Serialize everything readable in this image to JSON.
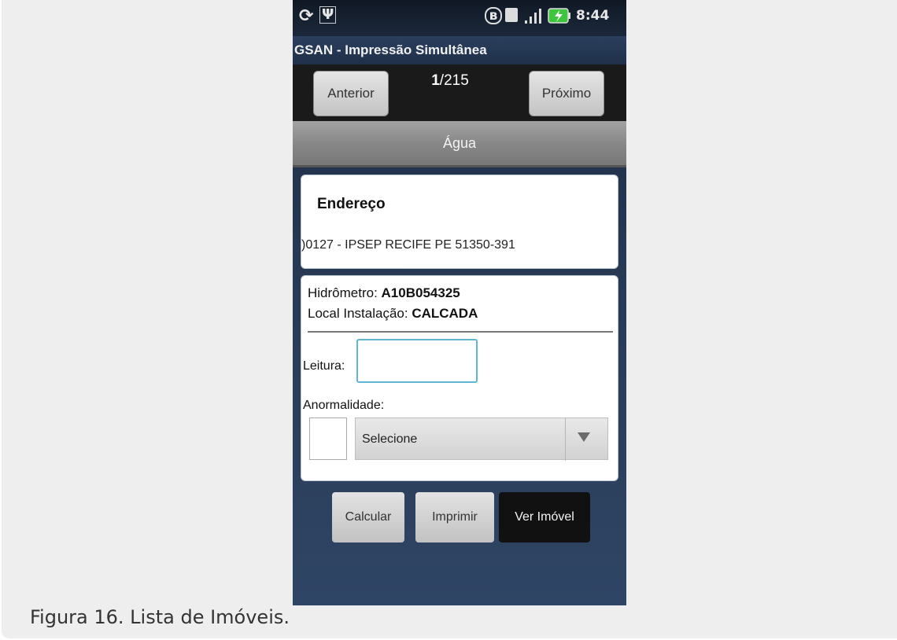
{
  "caption": "Figura 16. Lista de Imóveis.",
  "status_bar": {
    "time": "8:44"
  },
  "app": {
    "title": "GSAN - Impressão Simultânea"
  },
  "navigation": {
    "previous_label": "Anterior",
    "next_label": "Próximo",
    "current": "1",
    "total": "/215"
  },
  "section": {
    "title": "Água"
  },
  "address": {
    "heading": "Endereço",
    "text": ")0127 - IPSEP RECIFE PE 51350-391"
  },
  "meter": {
    "hidrometro_label": "Hidrômetro: ",
    "hidrometro_value": "A10B054325",
    "local_label": "Local Instalação: ",
    "local_value": "CALCADA"
  },
  "reading": {
    "leitura_label": "Leitura:",
    "leitura_value": "",
    "anormalidade_label": "Anormalidade:",
    "anormalidade_selected": "Selecione"
  },
  "actions": {
    "calcular": "Calcular",
    "imprimir": "Imprimir",
    "ver_imovel": "Ver Imóvel"
  },
  "colors": {
    "background": "#eeeeee",
    "phone_blue": "#2a3d57",
    "input_focus": "#5fb7d3",
    "battery_green": "#3ec53e"
  }
}
